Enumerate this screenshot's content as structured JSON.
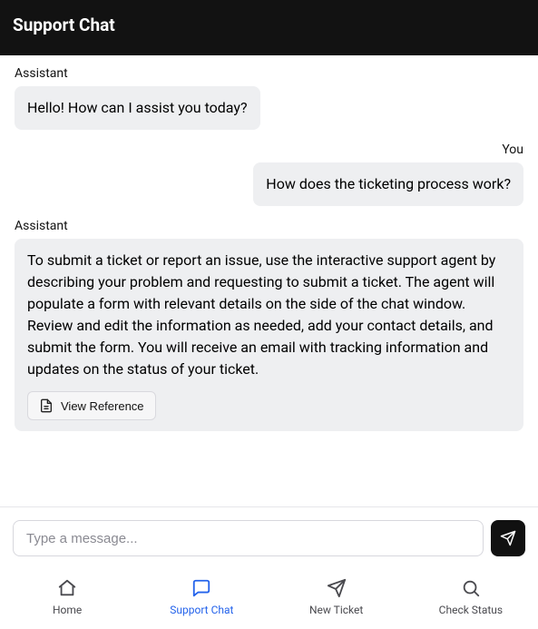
{
  "header": {
    "title": "Support Chat"
  },
  "messages": [
    {
      "role": "assistant",
      "sender": "Assistant",
      "text": "Hello! How can I assist you today?",
      "wide": false
    },
    {
      "role": "user",
      "sender": "You",
      "text": "How does the ticketing process work?",
      "wide": false
    },
    {
      "role": "assistant",
      "sender": "Assistant",
      "text": "To submit a ticket or report an issue, use the interactive support agent by describing your problem and requesting to submit a ticket. The agent will populate a form with relevant details on the side of the chat window. Review and edit the information as needed, add your contact details, and submit the form. You will receive an email with tracking information and updates on the status of your ticket.",
      "wide": true,
      "reference": true
    }
  ],
  "reference_label": "View Reference",
  "composer": {
    "placeholder": "Type a message..."
  },
  "tabs": {
    "home": "Home",
    "support_chat": "Support Chat",
    "new_ticket": "New Ticket",
    "check_status": "Check Status"
  }
}
